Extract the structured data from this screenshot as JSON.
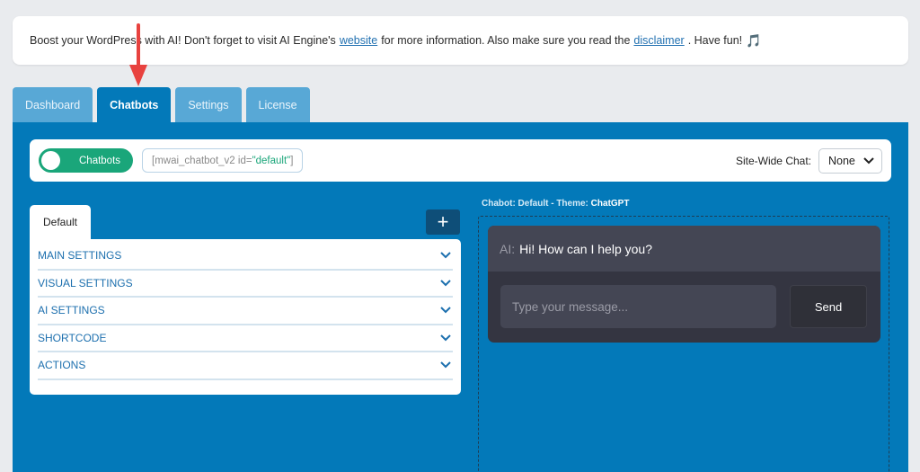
{
  "notice": {
    "text_before": "Boost your WordPress with AI! Don't forget to visit AI Engine's",
    "link_website": "website",
    "text_middle": "for more information. Also make sure you read the",
    "link_disclaimer": "disclaimer",
    "text_after": ". Have fun!",
    "emoji": "🎵"
  },
  "tabs": [
    {
      "label": "Dashboard",
      "active": false
    },
    {
      "label": "Chatbots",
      "active": true
    },
    {
      "label": "Settings",
      "active": false
    },
    {
      "label": "License",
      "active": false
    }
  ],
  "topbar": {
    "toggle_label": "Chatbots",
    "shortcode_prefix": "[mwai_chatbot_v2 id=",
    "shortcode_value": "\"default\"",
    "shortcode_suffix": "]",
    "sitewide_label": "Site-Wide Chat:",
    "sitewide_value": "None"
  },
  "chatbot_tab": "Default",
  "add_button": "+",
  "accordion": [
    "MAIN SETTINGS",
    "VISUAL SETTINGS",
    "AI SETTINGS",
    "SHORTCODE",
    "ACTIONS"
  ],
  "preview": {
    "title_prefix": "Chabot: Default - Theme: ",
    "title_theme": "ChatGPT",
    "ai_label": "AI:",
    "ai_message": "Hi! How can I help you?",
    "input_placeholder": "Type your message...",
    "send_label": "Send"
  },
  "colors": {
    "accent": "#0379b9",
    "toggle_on": "#1aa67a",
    "arrow": "#e8423f",
    "chat_bg": "#343541"
  }
}
